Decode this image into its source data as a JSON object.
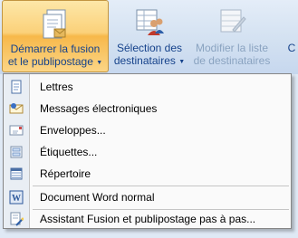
{
  "ribbon": {
    "merge_button": {
      "line1": "Démarrer la fusion",
      "line2": "et le publipostage",
      "icon": "merge-document-icon"
    },
    "select_button": {
      "line1": "Sélection des",
      "line2": "destinataires",
      "icon": "recipients-icon"
    },
    "modify_button": {
      "line1": "Modifier la liste",
      "line2": "de destinataires",
      "icon": "edit-list-icon"
    },
    "partial_button": {
      "line1": "C",
      "line2": ""
    }
  },
  "menu": {
    "items": [
      {
        "label": "Lettres",
        "icon": "letter-icon"
      },
      {
        "label": "Messages électroniques",
        "icon": "email-icon"
      },
      {
        "label": "Enveloppes...",
        "icon": "envelope-icon"
      },
      {
        "label": "Étiquettes...",
        "icon": "labels-icon"
      },
      {
        "label": "Répertoire",
        "icon": "directory-icon"
      },
      {
        "label": "Document Word normal",
        "icon": "word-document-icon"
      },
      {
        "label": "Assistant Fusion et publipostage pas à pas...",
        "icon": "wizard-icon"
      }
    ]
  },
  "colors": {
    "highlight": "#fbd17a",
    "menu_bg": "#fafafa",
    "ribbon_text": "#15428b",
    "disabled_text": "#8aa3c0"
  }
}
